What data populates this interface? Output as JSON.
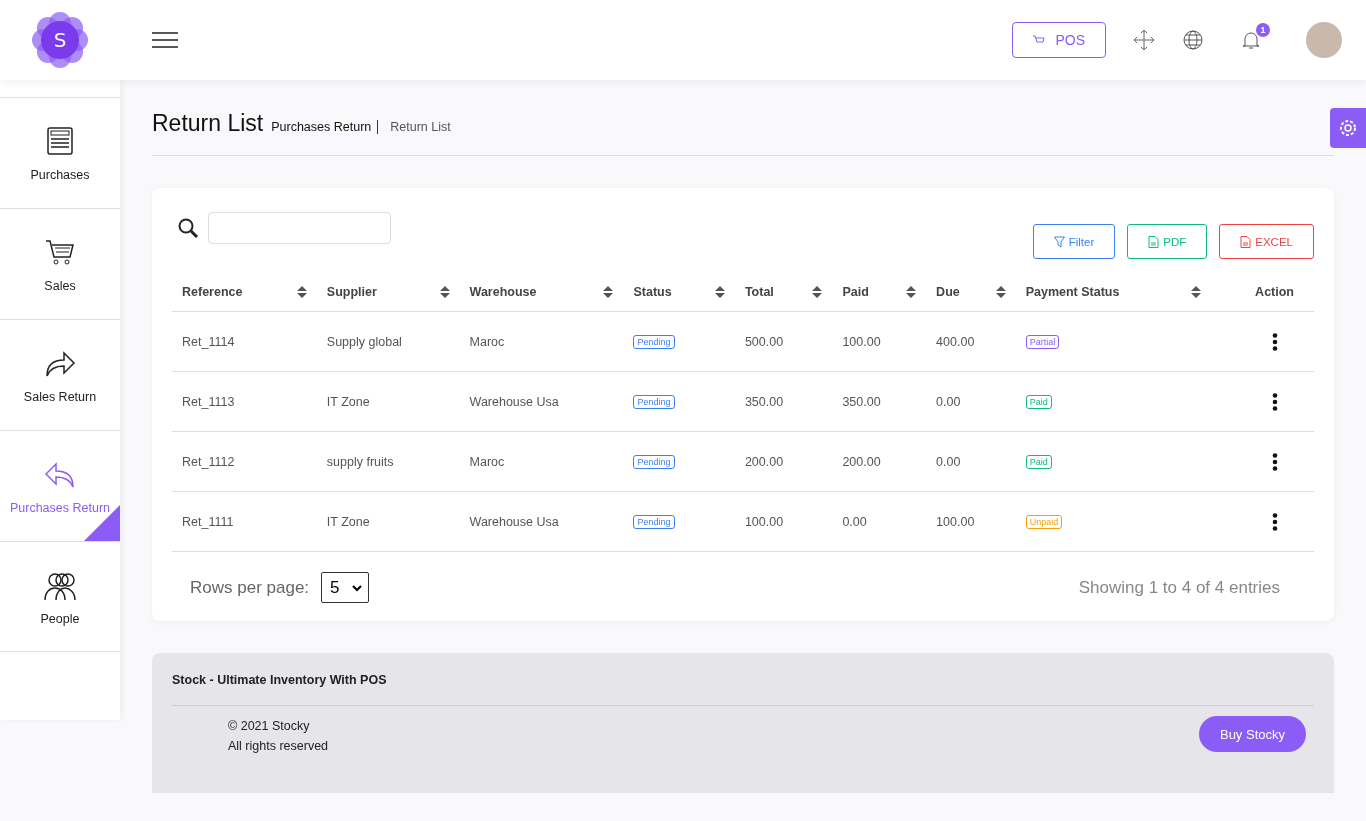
{
  "header": {
    "logo_letter": "S",
    "pos_button": "POS",
    "notification_count": "1"
  },
  "sidebar": {
    "items": [
      {
        "label": "Purchases",
        "selected": false
      },
      {
        "label": "Sales",
        "selected": false
      },
      {
        "label": "Sales Return",
        "selected": false
      },
      {
        "label": "Purchases Return",
        "selected": true
      },
      {
        "label": "People",
        "selected": false
      }
    ]
  },
  "page": {
    "title": "Return List",
    "breadcrumb": [
      "Purchases Return",
      "Return List"
    ]
  },
  "toolbar": {
    "buttons": [
      {
        "label": "Filter",
        "kind": "filter"
      },
      {
        "label": "PDF",
        "kind": "pdf"
      },
      {
        "label": "EXCEL",
        "kind": "excel"
      }
    ]
  },
  "table": {
    "columns": [
      {
        "label": "Reference",
        "sortable": true
      },
      {
        "label": "Supplier",
        "sortable": true
      },
      {
        "label": "Warehouse",
        "sortable": true
      },
      {
        "label": "Status",
        "sortable": true
      },
      {
        "label": "Total",
        "sortable": true
      },
      {
        "label": "Paid",
        "sortable": true
      },
      {
        "label": "Due",
        "sortable": true
      },
      {
        "label": "Payment Status",
        "sortable": true
      },
      {
        "label": "Action",
        "sortable": false
      }
    ],
    "rows": [
      {
        "reference": "Ret_1114",
        "supplier": "Supply global",
        "warehouse": "Maroc",
        "status": {
          "label": "Pending",
          "color": "#3b82f6"
        },
        "total": "500.00",
        "paid": "100.00",
        "due": "400.00",
        "payment_status": {
          "label": "Partial",
          "color": "#8b5cf6"
        }
      },
      {
        "reference": "Ret_1113",
        "supplier": "IT Zone",
        "warehouse": "Warehouse Usa",
        "status": {
          "label": "Pending",
          "color": "#3b82f6"
        },
        "total": "350.00",
        "paid": "350.00",
        "due": "0.00",
        "payment_status": {
          "label": "Paid",
          "color": "#10b981"
        }
      },
      {
        "reference": "Ret_1112",
        "supplier": "supply fruits",
        "warehouse": "Maroc",
        "status": {
          "label": "Pending",
          "color": "#3b82f6"
        },
        "total": "200.00",
        "paid": "200.00",
        "due": "0.00",
        "payment_status": {
          "label": "Paid",
          "color": "#10b981"
        }
      },
      {
        "reference": "Ret_1111",
        "supplier": "IT Zone",
        "warehouse": "Warehouse Usa",
        "status": {
          "label": "Pending",
          "color": "#3b82f6"
        },
        "total": "100.00",
        "paid": "0.00",
        "due": "100.00",
        "payment_status": {
          "label": "Unpaid",
          "color": "#f59e0b"
        }
      }
    ]
  },
  "pagination": {
    "rows_per_page_label": "Rows per page:",
    "rows_per_page": "5",
    "summary": "Showing 1 to 4 of 4 entries"
  },
  "footer": {
    "title": "Stock - Ultimate Inventory With POS",
    "copyright": "© 2021 Stocky",
    "rights": "All rights reserved",
    "buy_button": "Buy Stocky"
  }
}
